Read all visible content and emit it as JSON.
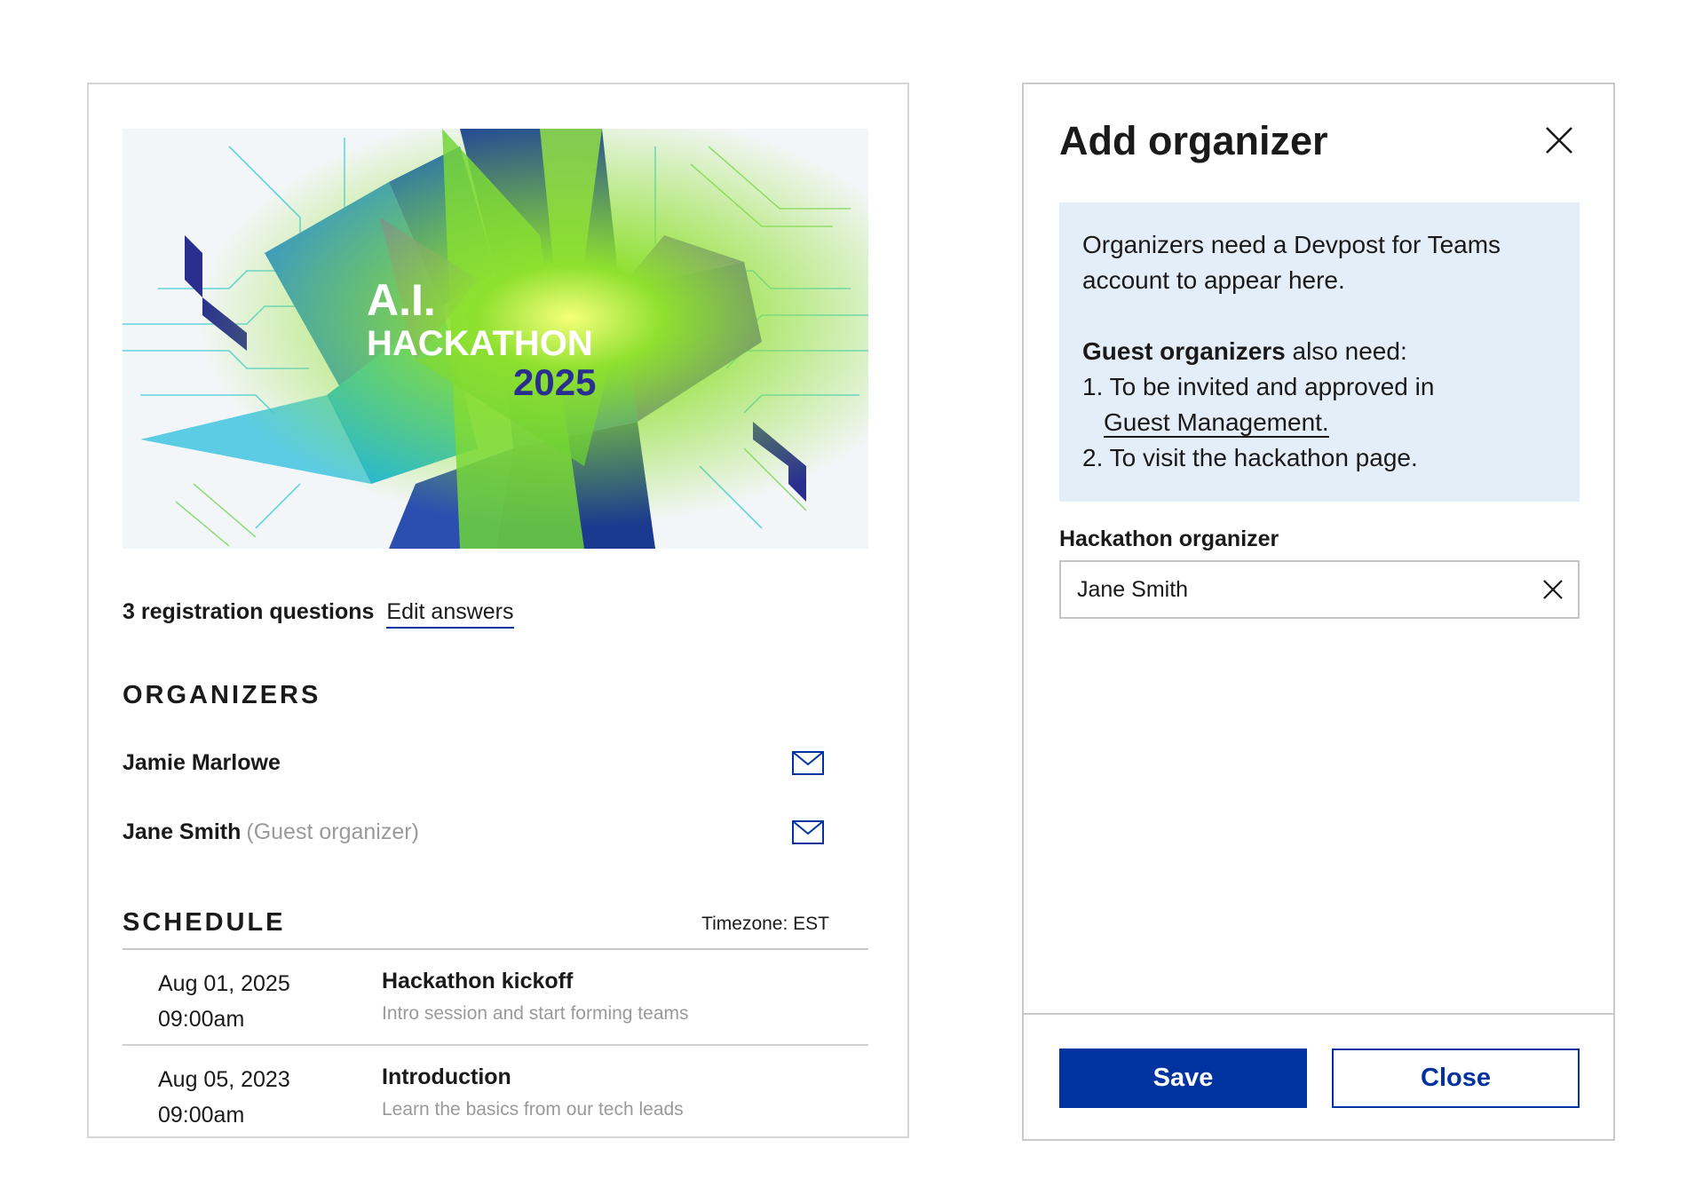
{
  "banner": {
    "line1": "A.I.",
    "line2": "HACKATHON",
    "line3": "2025"
  },
  "registration": {
    "count_label": "3 registration questions",
    "edit_label": "Edit answers"
  },
  "organizers": {
    "title": "ORGANIZERS",
    "items": [
      {
        "name": "Jamie Marlowe",
        "note": ""
      },
      {
        "name": "Jane Smith",
        "note": "(Guest organizer)"
      }
    ]
  },
  "schedule": {
    "title": "SCHEDULE",
    "timezone": "Timezone:  EST",
    "items": [
      {
        "date": "Aug 01, 2025",
        "time": "09:00am",
        "name": "Hackathon kickoff",
        "desc": "Intro session and start forming teams"
      },
      {
        "date": "Aug 05, 2023",
        "time": "09:00am",
        "name": "Introduction",
        "desc": "Learn the basics from our tech leads"
      }
    ]
  },
  "panel": {
    "title": "Add organizer",
    "info_line1": "Organizers need a Devpost for Teams account to appear here.",
    "info_guest_bold": "Guest organizers",
    "info_guest_rest": " also need:",
    "step1_text": "1. To be invited and approved in",
    "step1_link": "Guest Management.",
    "step2_text": "2. To visit the hackathon page.",
    "field_label": "Hackathon organizer",
    "field_value": "Jane Smith",
    "save_label": "Save",
    "close_label": "Close"
  },
  "colors": {
    "primary": "#0033a0",
    "info_bg": "#e3eef8",
    "muted_text": "#9a9a9a"
  },
  "icons": [
    "mail-icon",
    "close-icon",
    "clear-icon"
  ]
}
